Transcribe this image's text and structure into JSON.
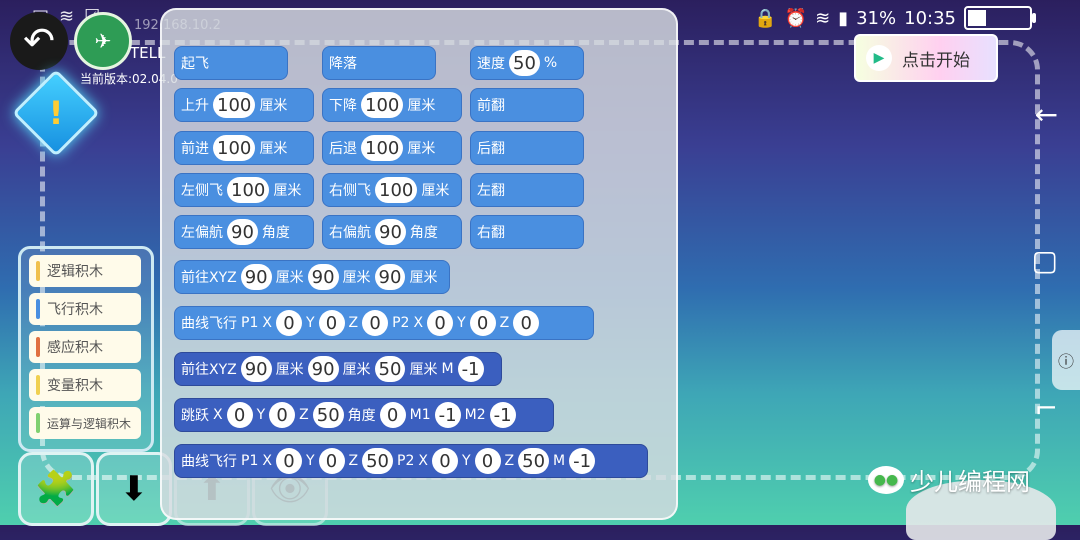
{
  "status_bar": {
    "battery": "31%",
    "time": "10:35",
    "battery_level": 0.31
  },
  "header": {
    "ip": "192.168.10.2",
    "device": "TELL",
    "version": "当前版本:02.04.0"
  },
  "start_button": {
    "label": "点击开始"
  },
  "categories": [
    "逻辑积木",
    "飞行积木",
    "感应积木",
    "变量积木",
    "运算与逻辑积木"
  ],
  "category_colors": [
    "#f0c04c",
    "#4a8fe0",
    "#e07040",
    "#f0d050",
    "#80d070"
  ],
  "blocks": {
    "takeoff": "起飞",
    "land": "降落",
    "speed": {
      "label": "速度",
      "value": "50",
      "unit": "%"
    },
    "up": {
      "label": "上升",
      "value": "100",
      "unit": "厘米"
    },
    "down": {
      "label": "下降",
      "value": "100",
      "unit": "厘米"
    },
    "flip_forward": "前翻",
    "forward": {
      "label": "前进",
      "value": "100",
      "unit": "厘米"
    },
    "back": {
      "label": "后退",
      "value": "100",
      "unit": "厘米"
    },
    "flip_back": "后翻",
    "left": {
      "label": "左侧飞",
      "value": "100",
      "unit": "厘米"
    },
    "right": {
      "label": "右侧飞",
      "value": "100",
      "unit": "厘米"
    },
    "flip_left": "左翻",
    "yaw_left": {
      "label": "左偏航",
      "value": "90",
      "unit": "角度"
    },
    "yaw_right": {
      "label": "右偏航",
      "value": "90",
      "unit": "角度"
    },
    "flip_right": "右翻",
    "goto": {
      "label": "前往XYZ",
      "x": "90",
      "y": "90",
      "z": "90",
      "unit": "厘米"
    },
    "curve": {
      "label": "曲线飞行",
      "p1": "P1",
      "x1": "0",
      "y1": "0",
      "z1": "0",
      "p2": "P2",
      "x2": "0",
      "y2": "0",
      "z2": "0"
    },
    "goto_m": {
      "label": "前往XYZ",
      "x": "90",
      "y": "90",
      "z": "50",
      "unit": "厘米",
      "m_label": "M",
      "m": "-1"
    },
    "jump": {
      "label": "跳跃",
      "x": "0",
      "y": "0",
      "z": "50",
      "angle_label": "角度",
      "angle": "0",
      "m1_label": "M1",
      "m1": "-1",
      "m2_label": "M2",
      "m2": "-1"
    },
    "curve_m": {
      "label": "曲线飞行",
      "p1": "P1",
      "x1": "0",
      "y1": "0",
      "z1": "50",
      "p2": "P2",
      "x2": "0",
      "y2": "0",
      "z2": "50",
      "m_label": "M",
      "m": "-1"
    },
    "axis": {
      "x": "X",
      "y": "Y",
      "z": "Z"
    }
  },
  "watermark": "少儿编程网"
}
